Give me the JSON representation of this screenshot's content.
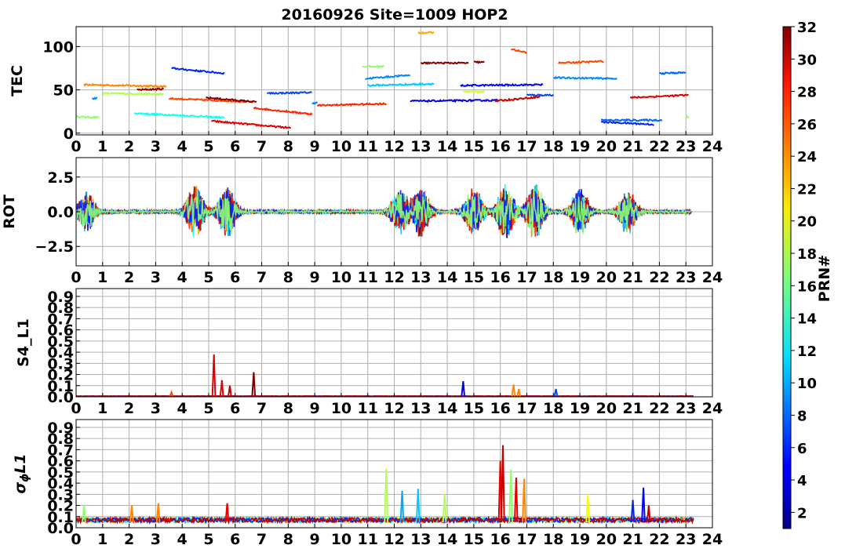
{
  "chart_data": {
    "title": "20160926 Site=1009 HOP2",
    "type": "line",
    "x_ticks": [
      0,
      1,
      2,
      3,
      4,
      5,
      6,
      7,
      8,
      9,
      10,
      11,
      12,
      13,
      14,
      15,
      16,
      17,
      18,
      19,
      20,
      21,
      22,
      23,
      24
    ],
    "xlim": [
      0,
      24
    ],
    "grid": true,
    "colorbar": {
      "label": "PRN#",
      "range": [
        1,
        32
      ],
      "ticks": [
        2,
        4,
        6,
        8,
        10,
        12,
        14,
        16,
        18,
        20,
        22,
        24,
        26,
        28,
        30,
        32
      ],
      "colormap": "jet"
    },
    "panels": [
      {
        "key": "tec",
        "ylabel": "TEC",
        "ylim": [
          -2,
          123
        ],
        "yticks": [
          0,
          50,
          100
        ],
        "ytick_labels": [
          "0",
          "50",
          "100"
        ],
        "arcs": [
          {
            "prn": 17,
            "start": 0.0,
            "end": 0.85,
            "y0": 19,
            "y1": 18
          },
          {
            "prn": 9,
            "start": 0.6,
            "end": 0.8,
            "y0": 40,
            "y1": 40
          },
          {
            "prn": 24,
            "start": 0.3,
            "end": 3.4,
            "y0": 56,
            "y1": 54
          },
          {
            "prn": 18,
            "start": 1.0,
            "end": 3.3,
            "y0": 46,
            "y1": 45
          },
          {
            "prn": 31,
            "start": 2.3,
            "end": 3.3,
            "y0": 50,
            "y1": 51
          },
          {
            "prn": 13,
            "start": 2.2,
            "end": 5.6,
            "y0": 23,
            "y1": 18
          },
          {
            "prn": 6,
            "start": 3.6,
            "end": 5.6,
            "y0": 75,
            "y1": 69
          },
          {
            "prn": 26,
            "start": 3.5,
            "end": 6.7,
            "y0": 40,
            "y1": 36
          },
          {
            "prn": 32,
            "start": 4.9,
            "end": 6.8,
            "y0": 41,
            "y1": 36
          },
          {
            "prn": 29,
            "start": 5.1,
            "end": 8.1,
            "y0": 14,
            "y1": 6
          },
          {
            "prn": 27,
            "start": 6.7,
            "end": 8.9,
            "y0": 29,
            "y1": 22
          },
          {
            "prn": 7,
            "start": 7.2,
            "end": 8.9,
            "y0": 46,
            "y1": 47
          },
          {
            "prn": 9,
            "start": 8.9,
            "end": 9.1,
            "y0": 35,
            "y1": 35
          },
          {
            "prn": 27,
            "start": 9.1,
            "end": 11.7,
            "y0": 32,
            "y1": 34
          },
          {
            "prn": 17,
            "start": 10.8,
            "end": 11.6,
            "y0": 77,
            "y1": 77
          },
          {
            "prn": 9,
            "start": 10.9,
            "end": 12.6,
            "y0": 63,
            "y1": 67
          },
          {
            "prn": 11,
            "start": 11.0,
            "end": 13.5,
            "y0": 55,
            "y1": 57
          },
          {
            "prn": 4,
            "start": 12.6,
            "end": 15.9,
            "y0": 37,
            "y1": 38
          },
          {
            "prn": 23,
            "start": 12.9,
            "end": 13.5,
            "y0": 116,
            "y1": 116
          },
          {
            "prn": 32,
            "start": 13.0,
            "end": 14.8,
            "y0": 81,
            "y1": 81
          },
          {
            "prn": 32,
            "start": 15.0,
            "end": 15.4,
            "y0": 82,
            "y1": 82
          },
          {
            "prn": 5,
            "start": 14.5,
            "end": 17.6,
            "y0": 55,
            "y1": 56
          },
          {
            "prn": 19,
            "start": 14.6,
            "end": 15.4,
            "y0": 48,
            "y1": 48
          },
          {
            "prn": 30,
            "start": 15.8,
            "end": 17.5,
            "y0": 37,
            "y1": 42
          },
          {
            "prn": 26,
            "start": 16.4,
            "end": 17.0,
            "y0": 97,
            "y1": 93
          },
          {
            "prn": 7,
            "start": 17.0,
            "end": 18.0,
            "y0": 44,
            "y1": 44
          },
          {
            "prn": 9,
            "start": 18.0,
            "end": 20.4,
            "y0": 64,
            "y1": 63
          },
          {
            "prn": 26,
            "start": 18.2,
            "end": 19.9,
            "y0": 81,
            "y1": 83
          },
          {
            "prn": 6,
            "start": 19.8,
            "end": 21.8,
            "y0": 13,
            "y1": 10
          },
          {
            "prn": 8,
            "start": 19.8,
            "end": 22.1,
            "y0": 15,
            "y1": 15
          },
          {
            "prn": 29,
            "start": 20.9,
            "end": 23.1,
            "y0": 41,
            "y1": 44
          },
          {
            "prn": 8,
            "start": 22.0,
            "end": 23.0,
            "y0": 69,
            "y1": 70
          },
          {
            "prn": 17,
            "start": 23.0,
            "end": 23.1,
            "y0": 19,
            "y1": 19
          }
        ]
      },
      {
        "key": "rot",
        "ylabel": "ROT",
        "ylim": [
          -3.9,
          3.9
        ],
        "yticks": [
          -2.5,
          0.0,
          2.5
        ],
        "ytick_labels": [
          "−2.5",
          "0.0",
          "2.5"
        ],
        "bursts": [
          {
            "center": 0.4,
            "amp": 2.6
          },
          {
            "center": 4.5,
            "amp": 3.7
          },
          {
            "center": 5.7,
            "amp": 3.6
          },
          {
            "center": 12.2,
            "amp": 3.0
          },
          {
            "center": 13.0,
            "amp": 3.4
          },
          {
            "center": 15.0,
            "amp": 3.4
          },
          {
            "center": 16.2,
            "amp": 3.9
          },
          {
            "center": 17.3,
            "amp": 3.9
          },
          {
            "center": 19.0,
            "amp": 3.3
          },
          {
            "center": 20.8,
            "amp": 3.0
          }
        ]
      },
      {
        "key": "s4",
        "ylabel": "S4_L1",
        "ylim": [
          0,
          0.97
        ],
        "yticks": [
          0,
          0.1,
          0.2,
          0.3,
          0.4,
          0.5,
          0.6,
          0.7,
          0.8,
          0.9
        ],
        "ytick_labels": [
          "0.0",
          "0.1",
          "0.2",
          "0.3",
          "0.4",
          "0.5",
          "0.6",
          "0.7",
          "0.8",
          "0.9"
        ],
        "spikes": [
          {
            "prn": 26,
            "x": 3.6,
            "peak": 0.04
          },
          {
            "prn": 29,
            "x": 5.2,
            "peak": 0.38
          },
          {
            "prn": 29,
            "x": 5.5,
            "peak": 0.15
          },
          {
            "prn": 30,
            "x": 5.8,
            "peak": 0.1
          },
          {
            "prn": 32,
            "x": 6.7,
            "peak": 0.22
          },
          {
            "prn": 4,
            "x": 14.6,
            "peak": 0.14
          },
          {
            "prn": 24,
            "x": 16.5,
            "peak": 0.11
          },
          {
            "prn": 24,
            "x": 16.7,
            "peak": 0.07
          },
          {
            "prn": 7,
            "x": 18.1,
            "peak": 0.07
          }
        ]
      },
      {
        "key": "sigma",
        "ylabel": "σϕL1",
        "ylim": [
          0,
          0.97
        ],
        "yticks": [
          0,
          0.1,
          0.2,
          0.3,
          0.4,
          0.5,
          0.6,
          0.7,
          0.8,
          0.9
        ],
        "ytick_labels": [
          "0.0",
          "0.1",
          "0.2",
          "0.3",
          "0.4",
          "0.5",
          "0.6",
          "0.7",
          "0.8",
          "0.9"
        ],
        "spikes": [
          {
            "prn": 17,
            "x": 0.3,
            "peak": 0.2
          },
          {
            "prn": 24,
            "x": 2.1,
            "peak": 0.2
          },
          {
            "prn": 24,
            "x": 3.1,
            "peak": 0.22
          },
          {
            "prn": 29,
            "x": 5.7,
            "peak": 0.22
          },
          {
            "prn": 18,
            "x": 11.7,
            "peak": 0.53
          },
          {
            "prn": 10,
            "x": 12.3,
            "peak": 0.33
          },
          {
            "prn": 11,
            "x": 12.9,
            "peak": 0.35
          },
          {
            "prn": 18,
            "x": 13.9,
            "peak": 0.3
          },
          {
            "prn": 29,
            "x": 16.0,
            "peak": 0.6
          },
          {
            "prn": 30,
            "x": 16.1,
            "peak": 0.74
          },
          {
            "prn": 17,
            "x": 16.4,
            "peak": 0.52
          },
          {
            "prn": 29,
            "x": 16.6,
            "peak": 0.45
          },
          {
            "prn": 24,
            "x": 16.9,
            "peak": 0.44
          },
          {
            "prn": 20,
            "x": 19.3,
            "peak": 0.3
          },
          {
            "prn": 6,
            "x": 21.0,
            "peak": 0.25
          },
          {
            "prn": 5,
            "x": 21.4,
            "peak": 0.36
          },
          {
            "prn": 30,
            "x": 21.6,
            "peak": 0.2
          }
        ]
      }
    ]
  }
}
